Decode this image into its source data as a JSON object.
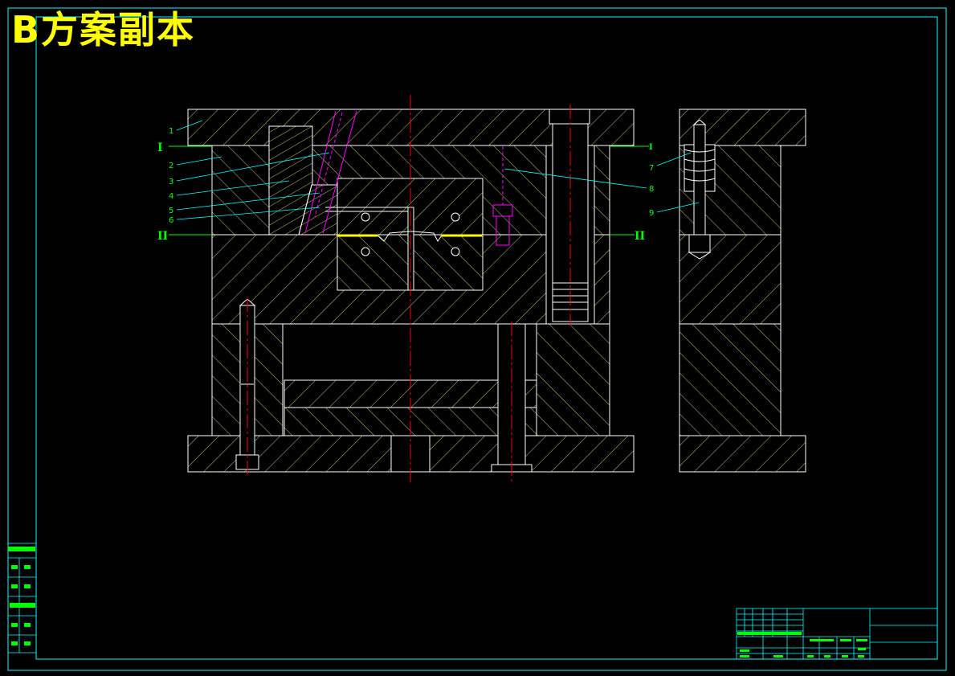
{
  "watermark": "B方案副本",
  "part_numbers": [
    "1",
    "2",
    "3",
    "4",
    "5",
    "6",
    "7",
    "8",
    "9"
  ],
  "section_marks": {
    "I_left": "I",
    "I_right": "I",
    "II_left": "II",
    "II_right": "II"
  },
  "colors": {
    "background": "#000000",
    "outline": "#ffffff",
    "hatch": "#c8c864",
    "centerline": "#ff0000",
    "leader": "#00ffff",
    "label": "#00ff00",
    "magenta": "#ff00ff",
    "border": "#00ffff",
    "watermark": "#ffff00"
  }
}
